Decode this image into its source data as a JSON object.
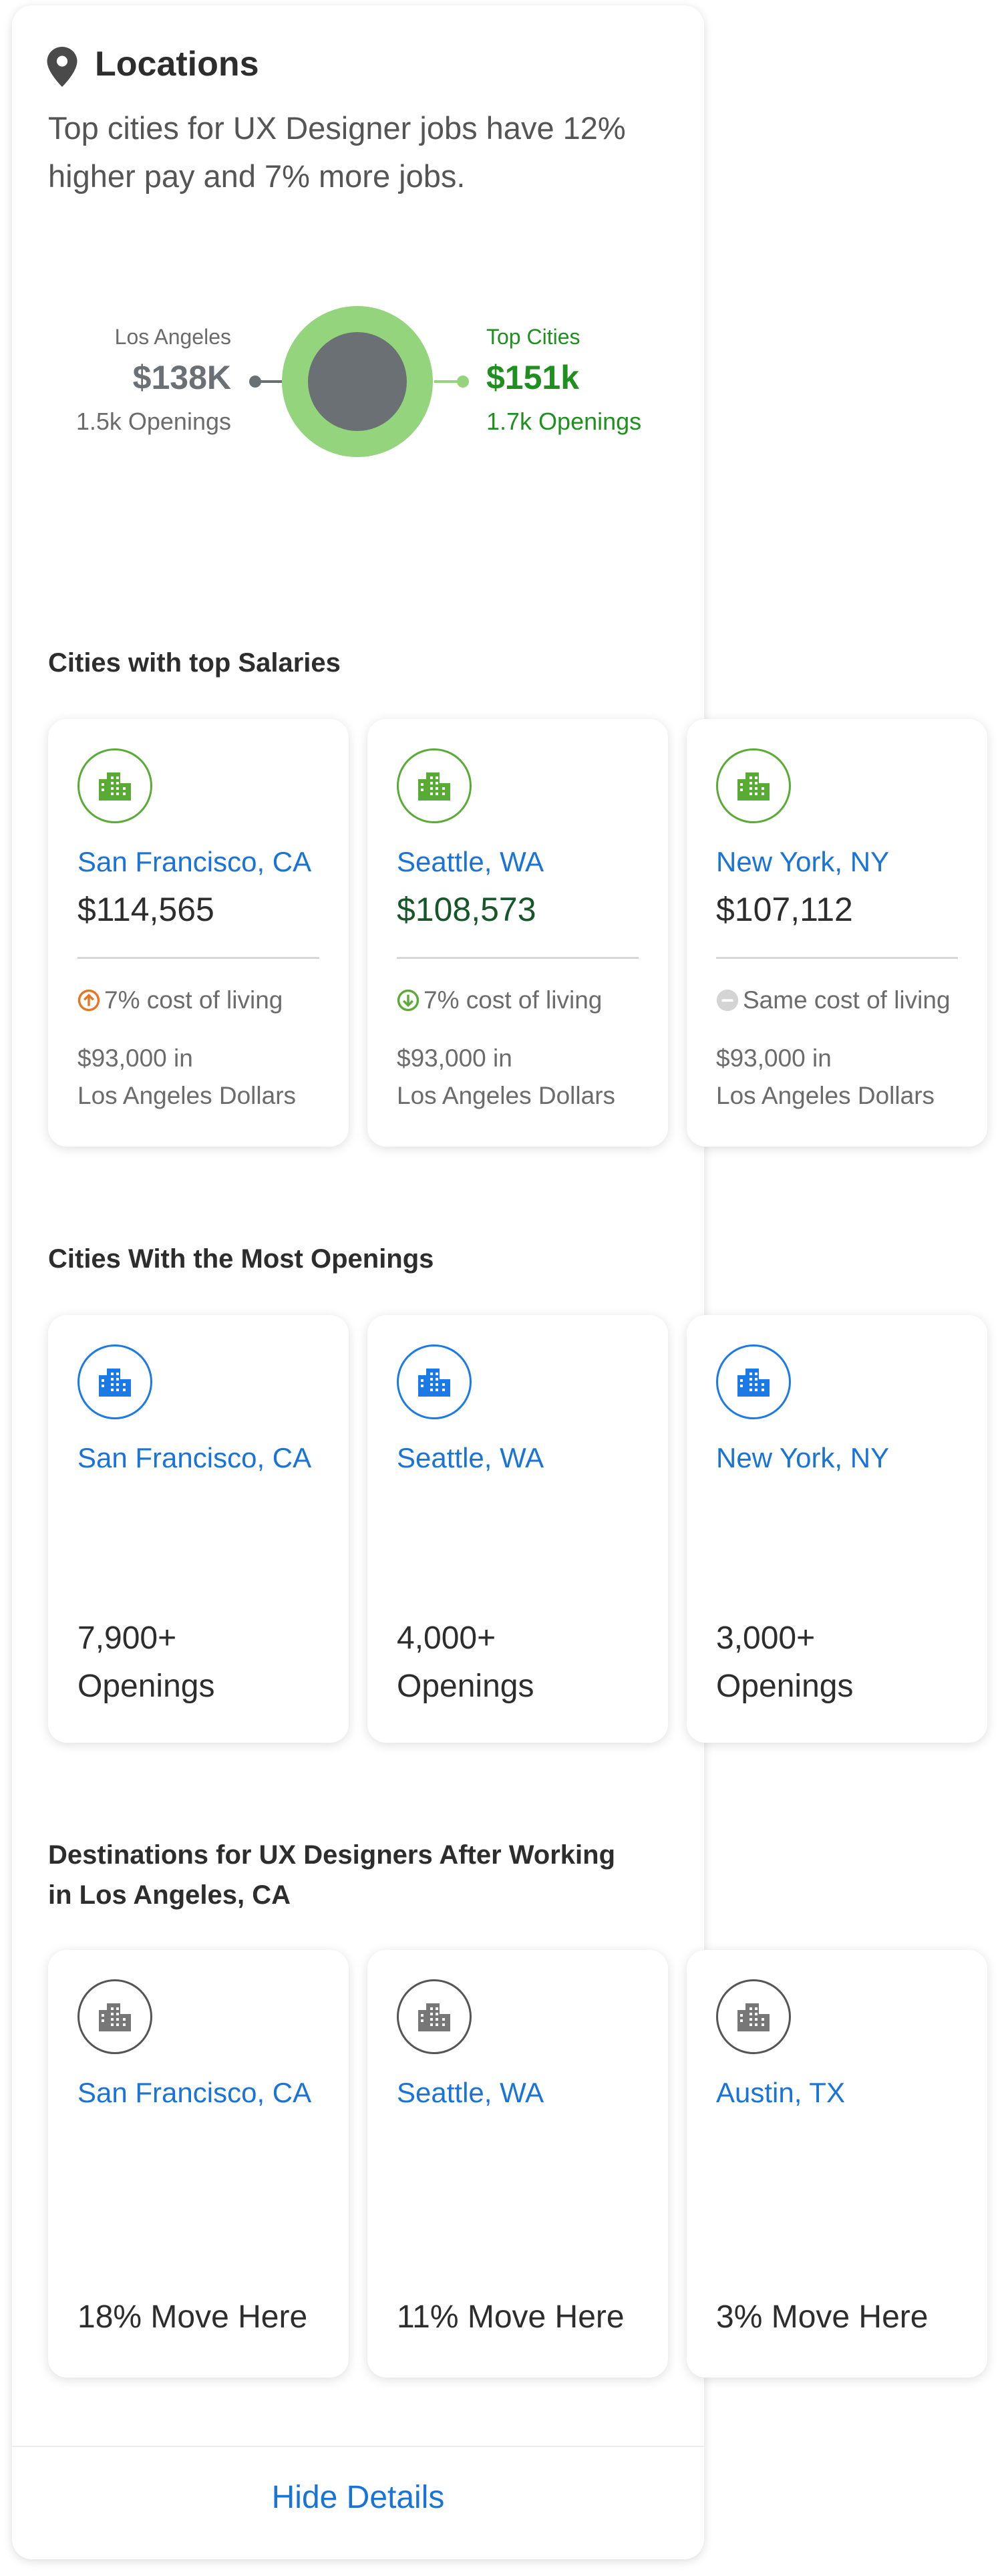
{
  "header": {
    "title": "Locations",
    "description": "Top cities for UX Designer jobs have 12% higher pay and 7% more jobs."
  },
  "comparison": {
    "left": {
      "label": "Los Angeles",
      "salary": "$138K",
      "openings": "1.5k Openings"
    },
    "right": {
      "label": "Top Cities",
      "salary": "$151k",
      "openings": "1.7k Openings"
    },
    "colors": {
      "left": "#6b7075",
      "right": "#1f8f1f",
      "ring": "#93d47c"
    }
  },
  "top_salaries": {
    "title": "Cities with top Salaries",
    "cards": [
      {
        "city": "San Francisco, CA",
        "salary": "$114,565",
        "cost": "7% cost of living",
        "cost_dir": "up",
        "equiv_line1": "$93,000 in",
        "equiv_line2": "Los Angeles Dollars"
      },
      {
        "city": "Seattle, WA",
        "salary": "$108,573",
        "cost": "7% cost of living",
        "cost_dir": "down",
        "equiv_line1": "$93,000 in",
        "equiv_line2": "Los Angeles Dollars"
      },
      {
        "city": "New York, NY",
        "salary": "$107,112",
        "cost": "Same cost of living",
        "cost_dir": "same",
        "equiv_line1": "$93,000 in",
        "equiv_line2": "Los Angeles Dollars"
      }
    ]
  },
  "most_openings": {
    "title": "Cities With the Most Openings",
    "cards": [
      {
        "city": "San Francisco, CA",
        "count": "7,900+",
        "unit": "Openings"
      },
      {
        "city": "Seattle, WA",
        "count": "4,000+",
        "unit": "Openings"
      },
      {
        "city": "New York, NY",
        "count": "3,000+",
        "unit": "Openings"
      }
    ]
  },
  "destinations": {
    "title_line1": "Destinations for UX Designers After Working",
    "title_line2": "in Los Angeles, CA",
    "cards": [
      {
        "city": "San Francisco, CA",
        "move": "18% Move Here"
      },
      {
        "city": "Seattle, WA",
        "move": "11% Move Here"
      },
      {
        "city": "Austin, TX",
        "move": "3% Move Here"
      }
    ]
  },
  "footer": {
    "hide_label": "Hide Details"
  },
  "icons": {
    "header": "map-pin-icon",
    "salary_cards": "building-icon-green",
    "openings_cards": "building-icon-blue",
    "destination_cards": "building-icon-gray",
    "cost_up": "arrow-up-circle-icon",
    "cost_down": "arrow-down-circle-icon",
    "cost_same": "minus-circle-icon"
  },
  "accent_colors": {
    "link": "#1a73d6",
    "green": "#5aab36",
    "blue": "#1c7ae6",
    "orange": "#e8741e"
  }
}
